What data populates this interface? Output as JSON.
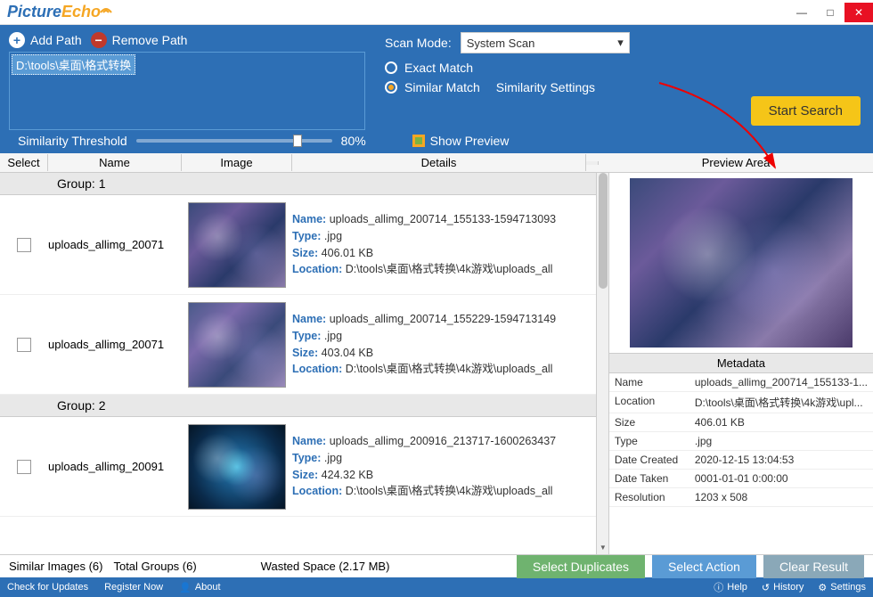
{
  "app": {
    "name1": "Picture",
    "name2": "Echo"
  },
  "win": {
    "min": "—",
    "max": "□",
    "close": "✕"
  },
  "toolbar": {
    "add_path": "Add Path",
    "remove_path": "Remove Path",
    "path_value": "D:\\tools\\桌面\\格式转换"
  },
  "scan": {
    "mode_label": "Scan Mode:",
    "mode_value": "System Scan",
    "exact": "Exact Match",
    "similar": "Similar Match",
    "settings": "Similarity Settings",
    "threshold_label": "Similarity Threshold",
    "threshold_value": "80%",
    "show_preview": "Show Preview",
    "start": "Start Search"
  },
  "cols": {
    "select": "Select",
    "name": "Name",
    "image": "Image",
    "details": "Details",
    "preview": "Preview Area"
  },
  "groups": [
    {
      "label": "Group: 1",
      "rows": [
        {
          "name": "uploads_allimg_20071",
          "det_name": "uploads_allimg_200714_155133-1594713093",
          "type": ".jpg",
          "size": "406.01 KB",
          "loc": "D:\\tools\\桌面\\格式转换\\4k游戏\\uploads_all",
          "thumb": "t1"
        },
        {
          "name": "uploads_allimg_20071",
          "det_name": "uploads_allimg_200714_155229-1594713149",
          "type": ".jpg",
          "size": "403.04 KB",
          "loc": "D:\\tools\\桌面\\格式转换\\4k游戏\\uploads_all",
          "thumb": "t2"
        }
      ]
    },
    {
      "label": "Group: 2",
      "rows": [
        {
          "name": "uploads_allimg_20091",
          "det_name": "uploads_allimg_200916_213717-1600263437",
          "type": ".jpg",
          "size": "424.32 KB",
          "loc": "D:\\tools\\桌面\\格式转换\\4k游戏\\uploads_all",
          "thumb": "t3"
        }
      ]
    }
  ],
  "labels": {
    "name": "Name:",
    "type": "Type:",
    "size": "Size:",
    "location": "Location:"
  },
  "metadata": {
    "header": "Metadata",
    "rows": [
      {
        "k": "Name",
        "v": "uploads_allimg_200714_155133-1..."
      },
      {
        "k": "Location",
        "v": "D:\\tools\\桌面\\格式转换\\4k游戏\\upl..."
      },
      {
        "k": "Size",
        "v": "406.01 KB"
      },
      {
        "k": "Type",
        "v": ".jpg"
      },
      {
        "k": "Date Created",
        "v": "2020-12-15 13:04:53"
      },
      {
        "k": "Date Taken",
        "v": "0001-01-01 0:00:00"
      },
      {
        "k": "Resolution",
        "v": "1203 x 508"
      }
    ]
  },
  "status": {
    "similar": "Similar Images (6)",
    "groups": "Total Groups (6)",
    "wasted": "Wasted Space (2.17 MB)",
    "select_dup": "Select Duplicates",
    "select_act": "Select Action",
    "clear": "Clear Result"
  },
  "footer": {
    "check": "Check for Updates",
    "register": "Register Now",
    "about": "About",
    "help": "Help",
    "history": "History",
    "settings": "Settings"
  }
}
